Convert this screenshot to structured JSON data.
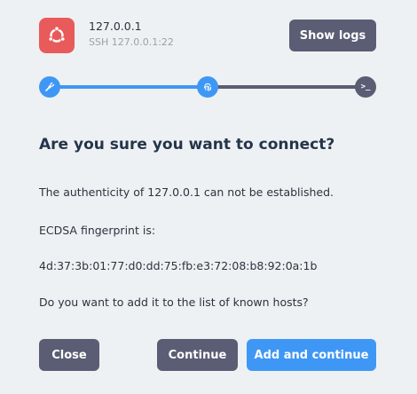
{
  "header": {
    "host": "127.0.0.1",
    "subtitle": "SSH 127.0.0.1:22",
    "show_logs_label": "Show logs",
    "icon": "ubuntu-icon",
    "icon_color": "#e95a5a"
  },
  "stepper": {
    "steps": [
      {
        "icon": "plug-icon",
        "state": "done"
      },
      {
        "icon": "fingerprint-icon",
        "state": "current"
      },
      {
        "icon": "terminal-icon",
        "state": "pending",
        "glyph": ">_"
      }
    ],
    "active_color": "#3f97f5",
    "inactive_color": "#5a5d73"
  },
  "dialog": {
    "title": "Are you sure you want to connect?",
    "authenticity": "The authenticity of 127.0.0.1 can not be established.",
    "fingerprint_label": "ECDSA fingerprint is:",
    "fingerprint": "4d:37:3b:01:77:d0:dd:75:fb:e3:72:08:b8:92:0a:1b",
    "question": "Do you want to add it to the list of known hosts?"
  },
  "footer": {
    "close_label": "Close",
    "continue_label": "Continue",
    "add_continue_label": "Add and continue"
  }
}
